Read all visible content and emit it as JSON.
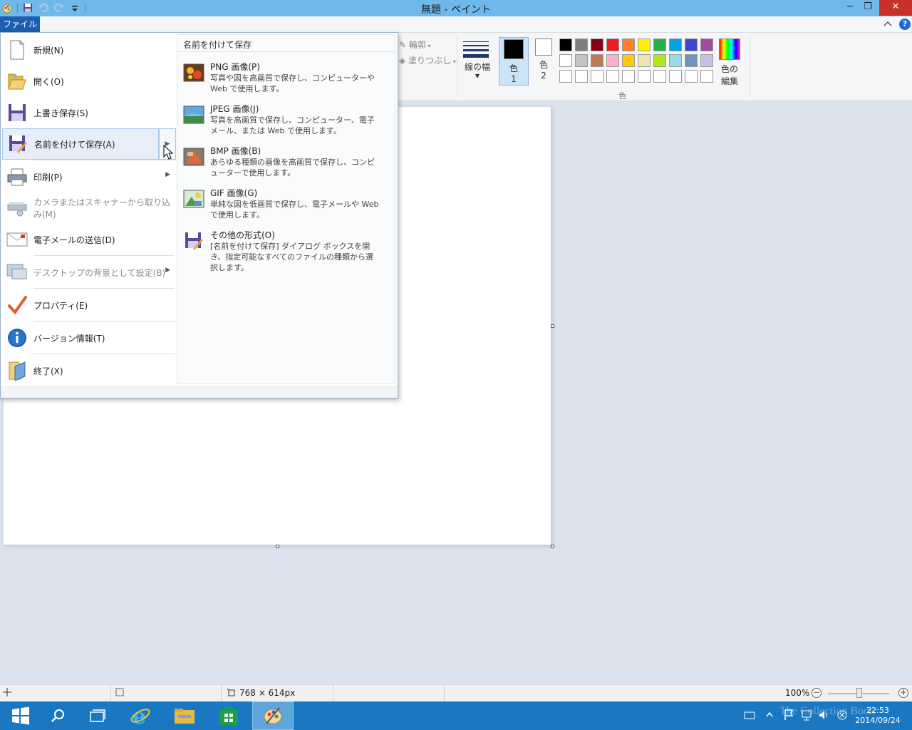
{
  "window": {
    "title": "無題 - ペイント",
    "minimize": "─",
    "restore": "❐",
    "close": "✕"
  },
  "tabs": {
    "file": "ファイル"
  },
  "ribbon": {
    "outline_label": "輪郭",
    "fill_label": "塗りつぶし",
    "size_label": "線の幅",
    "color1_label_a": "色",
    "color1_label_b": "1",
    "color2_label_a": "色",
    "color2_label_b": "2",
    "edit_colors_a": "色の",
    "edit_colors_b": "編集",
    "colors_group": "色",
    "color1": "#000000",
    "color2": "#ffffff",
    "palette": [
      "#000000",
      "#7f7f7f",
      "#880015",
      "#ed1c24",
      "#ff7f27",
      "#fff200",
      "#22b14c",
      "#00a2e8",
      "#3f48cc",
      "#a349a4",
      "#ffffff",
      "#c3c3c3",
      "#b97a57",
      "#ffaec9",
      "#ffc90e",
      "#efe4b0",
      "#b5e61d",
      "#99d9ea",
      "#7092be",
      "#c8bfe7",
      "#ffffff",
      "#ffffff",
      "#ffffff",
      "#ffffff",
      "#ffffff",
      "#ffffff",
      "#ffffff",
      "#ffffff",
      "#ffffff",
      "#ffffff"
    ]
  },
  "file_menu": {
    "items": [
      {
        "label": "新規(N)",
        "icon": "new-file-icon",
        "disabled": false
      },
      {
        "label": "開く(O)",
        "icon": "open-folder-icon",
        "disabled": false
      },
      {
        "label": "上書き保存(S)",
        "icon": "save-icon",
        "disabled": false
      },
      {
        "label": "名前を付けて保存(A)",
        "icon": "save-as-icon",
        "disabled": false
      },
      {
        "label": "印刷(P)",
        "icon": "printer-icon",
        "disabled": false
      },
      {
        "label": "カメラまたはスキャナーから取り込み(M)",
        "icon": "scanner-icon",
        "disabled": true
      },
      {
        "label": "電子メールの送信(D)",
        "icon": "email-icon",
        "disabled": false
      },
      {
        "label": "デスクトップの背景として設定(B)",
        "icon": "desktop-icon",
        "disabled": true
      },
      {
        "label": "プロパティ(E)",
        "icon": "checkmark-icon",
        "disabled": false
      },
      {
        "label": "バージョン情報(T)",
        "icon": "info-icon",
        "disabled": false
      },
      {
        "label": "終了(X)",
        "icon": "exit-icon",
        "disabled": false
      }
    ],
    "submenu": {
      "header": "名前を付けて保存",
      "items": [
        {
          "name": "PNG 画像(P)",
          "desc": "写真や図を高画質で保存し、コンピューターや Web で使用します。"
        },
        {
          "name": "JPEG 画像(J)",
          "desc": "写真を高画質で保存し、コンピューター、電子メール、または Web で使用します。"
        },
        {
          "name": "BMP 画像(B)",
          "desc": "あらゆる種類の画像を高画質で保存し、コンピューターで使用します。"
        },
        {
          "name": "GIF 画像(G)",
          "desc": "単純な図を低画質で保存し、電子メールや Web で使用します。"
        },
        {
          "name": "その他の形式(O)",
          "desc": "[名前を付けて保存] ダイアログ ボックスを開き、指定可能なすべてのファイルの種類から選択します。"
        }
      ]
    }
  },
  "statusbar": {
    "image_size": "768 × 614px",
    "zoom": "100%",
    "zoom_minus": "−",
    "zoom_plus": "+"
  },
  "taskbar": {
    "time": "22:53",
    "date": "2014/09/24",
    "watermark": "The Collection Book"
  }
}
